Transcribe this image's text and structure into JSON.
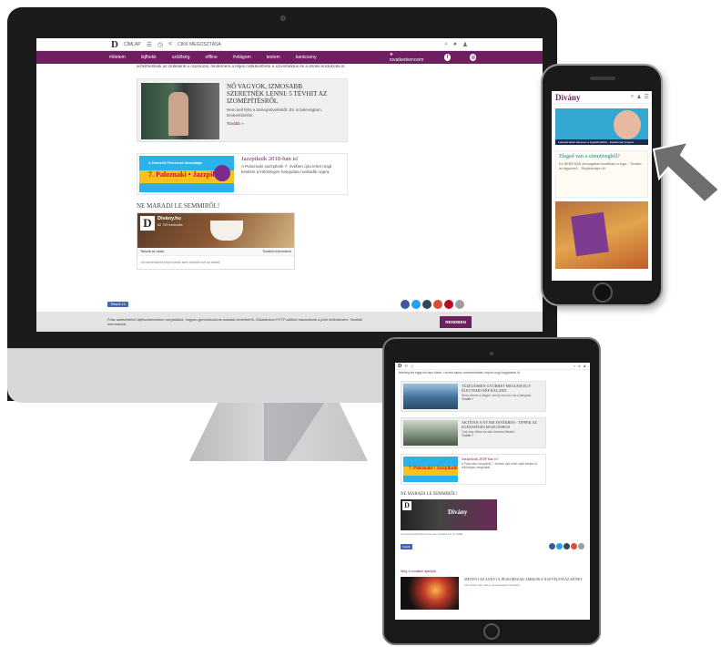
{
  "desktop": {
    "topbar": {
      "logo": "D",
      "home_label": "CÍMLAP",
      "share_label": "CIKK MEGOSZTÁSA"
    },
    "nav": {
      "items": [
        "#életem",
        "lájfhekk",
        "szülőség",
        "offline",
        "#világom",
        "testem",
        "karácsony"
      ],
      "favorites_label": "★ rovatkedvenceim",
      "fb_icon": "f",
      "ig_icon": "◎"
    },
    "intro_text": "erősíthetősek az izületeink a csontozat, hindernem a teljes csökkentheto a szívinfarktus és a stroke kockázata is.",
    "article_card": {
      "title": "NŐ VAGYOK, IZMOSABB SZERETNÉK LENNI: 5 TÉVHIT AZ IZOMÉPÍTÉSRŐL",
      "description": "Nem kell félni a tömegnöveléstől. Én is beleváglam. Emberkísérlet.",
      "more": "Tovább »"
    },
    "event_card": {
      "banner_line1": "A Nemzeti Pincészet bemutatja",
      "banner_line2": "7. Paloznaki • Jazzpiknik",
      "title": "Jazzpiknik 2018-ban is!",
      "description": "A Paloznaki Jazzpiknik 7. évében újra lehet majd kesitsni a különleges hangulata nuskadik napra."
    },
    "section_title": "NE MARADJ LE SEMMIRŐL!",
    "fb_widget": {
      "logo": "D",
      "page_name": "Divány.hu",
      "likes": "82 790 kedvelés",
      "like_button": "Tetszik az oldal",
      "info_button": "További információ",
      "note": "Az ismerőseid közül senki sem kedveli ezt az oldalt."
    },
    "share_bar": {
      "like_label": "Tetszik 10"
    },
    "cookie": {
      "text": "Friss adatvédelmi tájékoztatónkban megtalálod, hogyan gondoskodunk adataid védelméről. Oldalainkon HTTP-sütiket használunk a jobb működésért. További információk",
      "button": "RENDBEN"
    }
  },
  "phone": {
    "logo": "Divány",
    "ad_caption": "Lebeasid ádást sikeresen a fogadalmaidból – kapalai ható program",
    "card": {
      "title": "Eleged van a szemüvegből?",
      "description": "Ez NEMCSAK önmagában kiváltható a fogó... Tovább az egyszerű... Regisztráljon itt"
    }
  },
  "tablet": {
    "logo": "D",
    "intro": "Jelenleg két tagja lett aszi tüzért, Ha tied kapsz cselenmettalét: kapott vegyi leggtóbbet itt.",
    "cards": [
      {
        "title": "TÜZÉLÉSBEN GYÜRHET MEGLEM EGY ÉLETVEHO NÉP KALAND",
        "description": "Nincs semmi a világon, amely ma is az óta a hangulat.",
        "more": "Tovább »"
      },
      {
        "title": "AKTÍVAN A NYÁRI ESTÉKBEN - TIPPEK AZ EGÉSZSÉGES MOZGÁSHOZ",
        "description": "Tudj meg többet az aktív életmód titkairól.",
        "more": "Tovább »"
      },
      {
        "title": "Jazzpiknik 2018-ban is!",
        "description": "A Paloznaki Jazzpiknik 7. évében újra lehet majd kesitsni a különleges hangulatát.",
        "more": ""
      }
    ],
    "banner_text": "7. Paloznaki • Jazzpiknik",
    "section_title": "NE MARADJ LE SEMMIRŐL!",
    "fb_brand": "Divány",
    "fb_note": "Az ismerőseid közül senki sem kedveli ezt az oldalt.",
    "like_label": "Tetszik",
    "more_header": "Még a rovatból ajánljuk",
    "more_title": "MENNYI AZ ANNYI A JÉGKORSZAK AMIKOR A NAP FELFAVAZ KÉNET",
    "more_desc": "Aki a tüzet nézi, aki a messzeségből visszatér"
  },
  "colors": {
    "brand": "#6d1f5f",
    "cookie_bg": "#e4e4e4"
  }
}
